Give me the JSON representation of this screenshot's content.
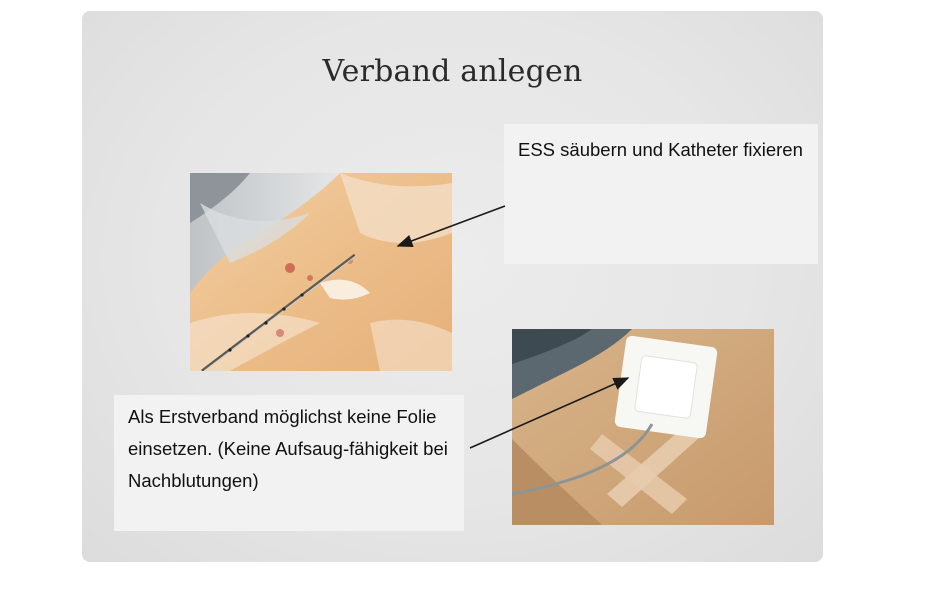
{
  "slide": {
    "title": "Verband anlegen",
    "callouts": [
      {
        "text": "ESS säubern und Katheter fixieren"
      },
      {
        "text": "Als Erstverband möglichst keine Folie einsetzen. (Keine Aufsaug-fähigkeit bei Nachblutungen)"
      }
    ]
  },
  "colors": {
    "slide_background": "#e6e6e6",
    "callout_background": "#f2f2f2",
    "text": "#111111"
  }
}
